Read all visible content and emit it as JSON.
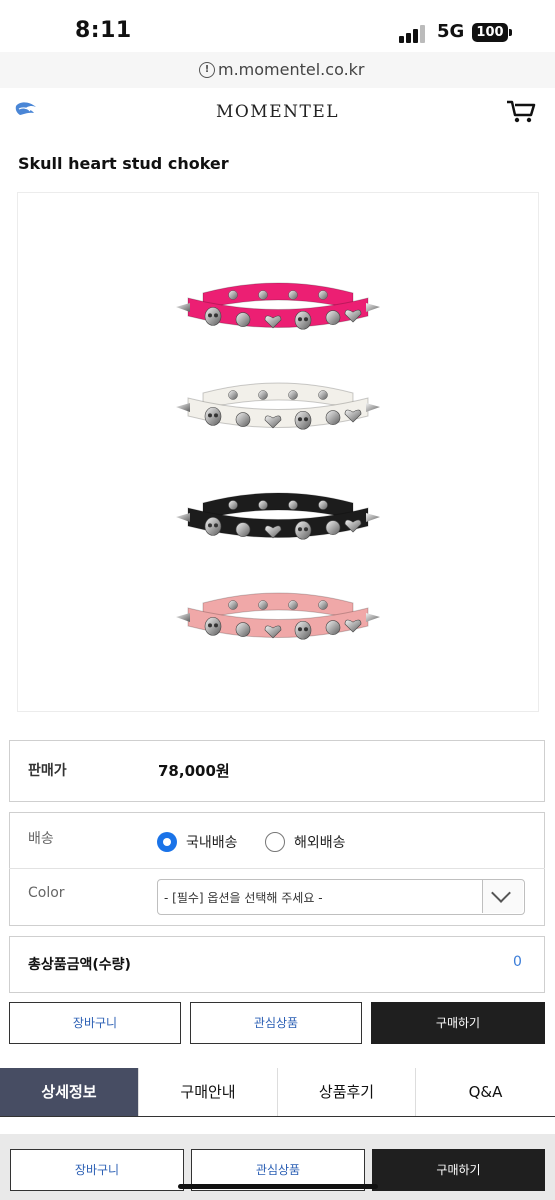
{
  "status_bar": {
    "time": "8:11",
    "network": "5G",
    "battery": "100"
  },
  "browser": {
    "url": "m.momentel.co.kr"
  },
  "header": {
    "brand": "MOMENTEL"
  },
  "product": {
    "title": "Skull heart stud choker",
    "chokers": [
      {
        "color": "#ec1f73"
      },
      {
        "color": "#f2f0ea"
      },
      {
        "color": "#1c1c1c"
      },
      {
        "color": "#f0a8a8"
      }
    ]
  },
  "price": {
    "label": "판매가",
    "value": "78,000원"
  },
  "shipping": {
    "label": "배송",
    "options": [
      {
        "label": "국내배송",
        "selected": true
      },
      {
        "label": "해외배송",
        "selected": false
      }
    ]
  },
  "color_option": {
    "label": "Color",
    "placeholder": "- [필수] 옵션을 선택해 주세요 -"
  },
  "total": {
    "label": "총상품금액(수량)",
    "value": "0"
  },
  "actions": {
    "cart": "장바구니",
    "wishlist": "관심상품",
    "buy": "구매하기"
  },
  "tabs": [
    {
      "label": "상세정보",
      "active": true
    },
    {
      "label": "구매안내",
      "active": false
    },
    {
      "label": "상품후기",
      "active": false
    },
    {
      "label": "Q&A",
      "active": false
    }
  ],
  "bottom_bar": {
    "cart": "장바구니",
    "wishlist": "관심상품",
    "buy": "구매하기"
  }
}
